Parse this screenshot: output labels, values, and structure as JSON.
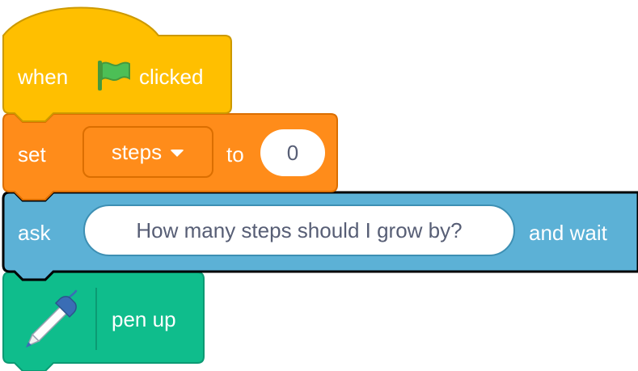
{
  "hat_block": {
    "when_label": "when",
    "flag_icon": "green-flag-icon",
    "clicked_label": "clicked",
    "color": "#ffbf00"
  },
  "set_block": {
    "set_label": "set",
    "variable": "steps",
    "caret_icon": "dropdown-caret-icon",
    "to_label": "to",
    "value": "0",
    "color": "#ff8c1a"
  },
  "ask_block": {
    "ask_label": "ask",
    "question": "How many steps should I grow by?",
    "wait_label": "and wait",
    "color": "#5cb1d6"
  },
  "pen_block": {
    "icon": "pen-icon",
    "label": "pen up",
    "color": "#0fbd8c"
  }
}
